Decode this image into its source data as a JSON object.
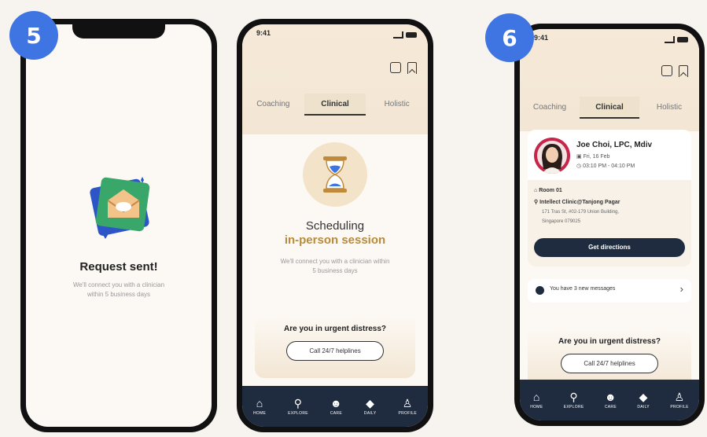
{
  "steps": {
    "left": "5",
    "right": "6"
  },
  "phone1": {
    "title": "Request sent!",
    "subtitle": "We'll connect you with a clinician within 5 business days"
  },
  "phone2": {
    "time": "9:41",
    "tabs": [
      "Coaching",
      "Clinical",
      "Holistic"
    ],
    "active_tab": "Clinical",
    "status_title_line1": "Scheduling",
    "status_title_line2": "in-person session",
    "status_subtitle": "We'll connect you with a clinician within 5 business days",
    "urgent_title": "Are you in urgent distress?",
    "helpline_button": "Call 24/7 helplines"
  },
  "phone3": {
    "time": "9:41",
    "tabs": [
      "Coaching",
      "Clinical",
      "Holistic"
    ],
    "active_tab": "Clinical",
    "clinician_name": "Joe Choi, LPC, Mdiv",
    "date": "Fri, 16 Feb",
    "time_range": "03:10 PM - 04:10 PM",
    "room": "Room 01",
    "clinic_name": "Intellect Clinic@Tanjong Pagar",
    "address_line1": "171 Tras St, #02-179 Union Building,",
    "address_line2": "Singapore 079025",
    "directions_button": "Get directions",
    "messages_text": "You have 3 new messages",
    "urgent_title": "Are you in urgent distress?",
    "helpline_button": "Call 24/7 helplines"
  },
  "nav": [
    {
      "label": "HOME",
      "icon": "home-icon"
    },
    {
      "label": "EXPLORE",
      "icon": "search-icon"
    },
    {
      "label": "CARE",
      "icon": "care-icon"
    },
    {
      "label": "DAILY",
      "icon": "diamond-icon"
    },
    {
      "label": "PROFILE",
      "icon": "profile-icon"
    }
  ],
  "colors": {
    "accent_blue": "#3f74e3",
    "navy": "#1f2c3f",
    "cream": "#fcf9f4",
    "beige": "#f3e6d4",
    "gold": "#b88a3a"
  }
}
